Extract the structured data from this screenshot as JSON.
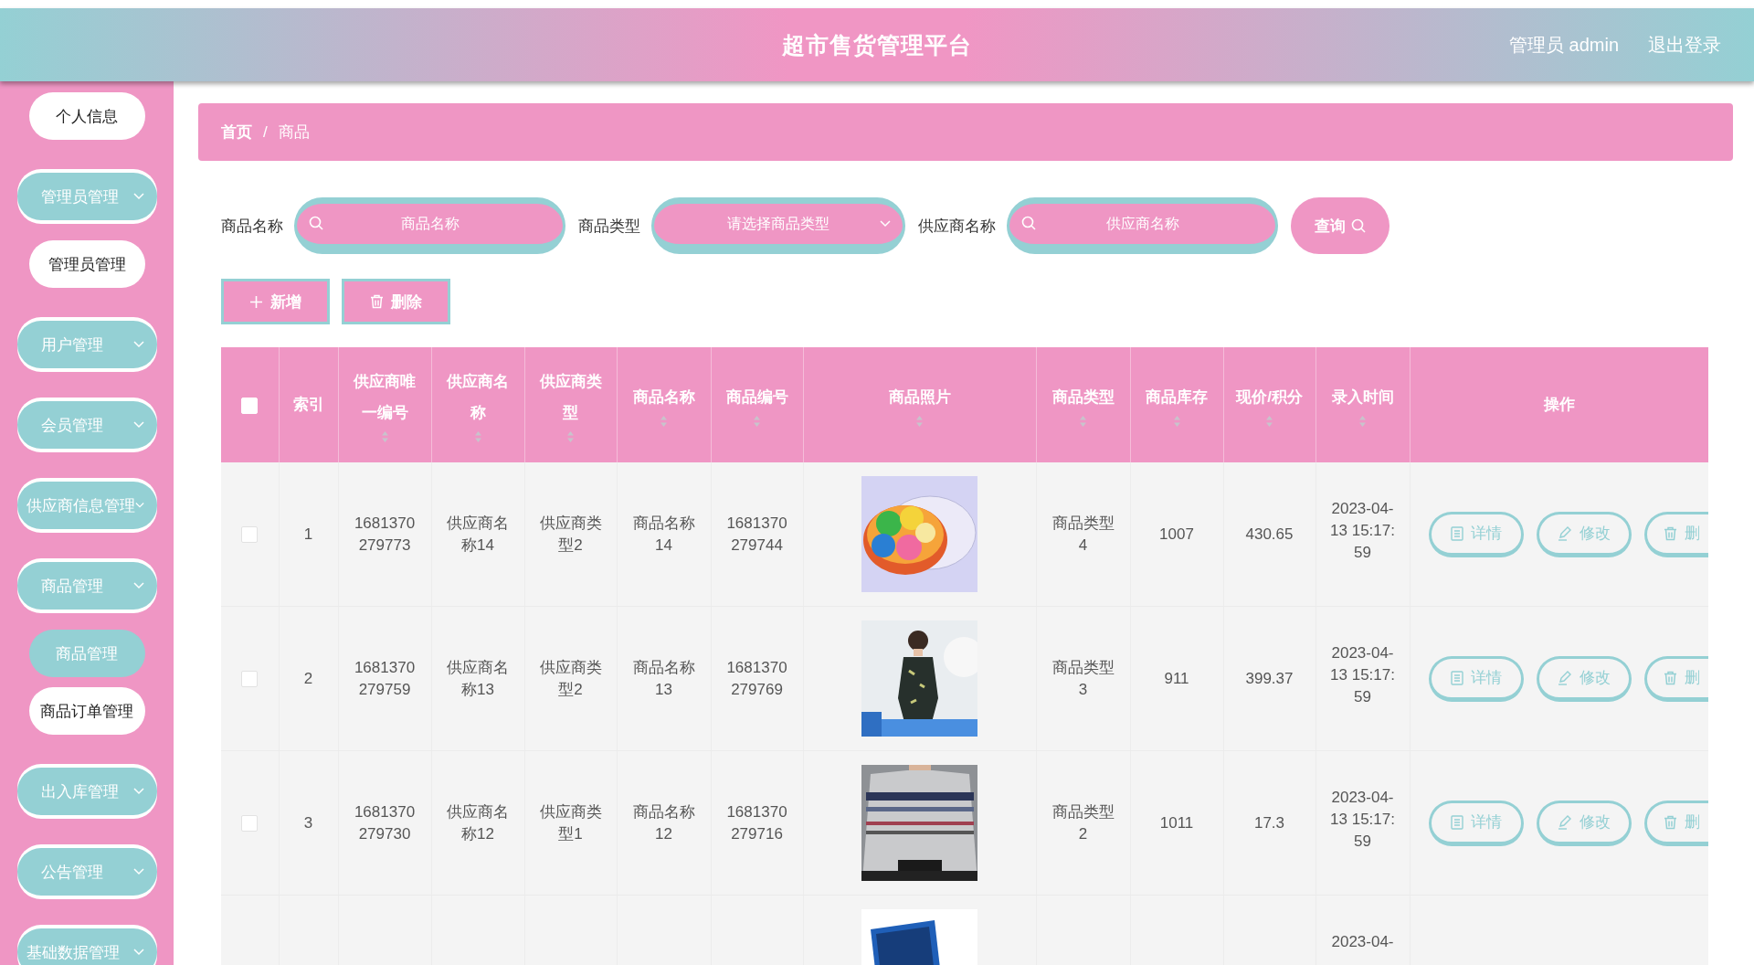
{
  "header": {
    "title": "超市售货管理平台",
    "user": "管理员 admin",
    "logout": "退出登录"
  },
  "sidebar": {
    "items": [
      {
        "kind": "item",
        "label": "个人信息",
        "selected": false
      },
      {
        "kind": "group",
        "label": "管理员管理",
        "children": [
          {
            "label": "管理员管理",
            "selected": false
          }
        ]
      },
      {
        "kind": "group",
        "label": "用户管理"
      },
      {
        "kind": "group",
        "label": "会员管理"
      },
      {
        "kind": "group",
        "label": "供应商信息管理"
      },
      {
        "kind": "group",
        "label": "商品管理",
        "children": [
          {
            "label": "商品管理",
            "selected": true
          },
          {
            "label": "商品订单管理",
            "selected": false
          }
        ]
      },
      {
        "kind": "group",
        "label": "出入库管理"
      },
      {
        "kind": "group",
        "label": "公告管理"
      },
      {
        "kind": "group",
        "label": "基础数据管理"
      }
    ]
  },
  "breadcrumb": [
    "首页",
    "商品"
  ],
  "breadcrumb_separator": "/",
  "filters": [
    {
      "kind": "input",
      "label": "商品名称",
      "placeholder": "商品名称"
    },
    {
      "kind": "select",
      "label": "商品类型",
      "placeholder": "请选择商品类型"
    },
    {
      "kind": "input",
      "label": "供应商名称",
      "placeholder": "供应商名称"
    }
  ],
  "search_button": "查询",
  "actions": [
    {
      "kind": "add",
      "label": "新增"
    },
    {
      "kind": "delete",
      "label": "删除"
    }
  ],
  "table": {
    "select_all": {
      "checked": false
    },
    "columns": [
      {
        "label": "索引",
        "sortable": false
      },
      {
        "label": "供应商唯一编号",
        "sortable": true
      },
      {
        "label": "供应商名称",
        "sortable": true
      },
      {
        "label": "供应商类型",
        "sortable": true
      },
      {
        "label": "商品名称",
        "sortable": true
      },
      {
        "label": "商品编号",
        "sortable": true
      },
      {
        "label": "商品照片",
        "sortable": true
      },
      {
        "label": "商品类型",
        "sortable": true
      },
      {
        "label": "商品库存",
        "sortable": true
      },
      {
        "label": "现价/积分",
        "sortable": true
      },
      {
        "label": "录入时间",
        "sortable": true
      },
      {
        "label": "操作",
        "sortable": false
      }
    ],
    "rows": [
      {
        "checked": false,
        "index": "1",
        "supplier_id": "1681370279773",
        "supplier_name": "供应商名称14",
        "supplier_type": "供应商类型2",
        "product_name": "商品名称14",
        "product_code": "1681370279744",
        "photo": {
          "kind": "picture"
        },
        "product_type": "商品类型4",
        "stock": "1007",
        "price": "430.65",
        "created": "2023-04-13 15:17:59",
        "buttons": [
          {
            "kind": "detail",
            "label": "详情"
          },
          {
            "kind": "edit",
            "label": "修改"
          },
          {
            "kind": "delete",
            "label": "删"
          }
        ]
      },
      {
        "checked": false,
        "index": "2",
        "supplier_id": "1681370279759",
        "supplier_name": "供应商名称13",
        "supplier_type": "供应商类型2",
        "product_name": "商品名称13",
        "product_code": "1681370279769",
        "photo": {
          "kind": "picture"
        },
        "product_type": "商品类型3",
        "stock": "911",
        "price": "399.37",
        "created": "2023-04-13 15:17:59",
        "buttons": [
          {
            "kind": "detail",
            "label": "详情"
          },
          {
            "kind": "edit",
            "label": "修改"
          },
          {
            "kind": "delete",
            "label": "删"
          }
        ]
      },
      {
        "checked": false,
        "index": "3",
        "supplier_id": "1681370279730",
        "supplier_name": "供应商名称12",
        "supplier_type": "供应商类型1",
        "product_name": "商品名称12",
        "product_code": "1681370279716",
        "photo": {
          "kind": "picture"
        },
        "product_type": "商品类型2",
        "stock": "1011",
        "price": "17.3",
        "created": "2023-04-13 15:17:59",
        "buttons": [
          {
            "kind": "detail",
            "label": "详情"
          },
          {
            "kind": "edit",
            "label": "修改"
          },
          {
            "kind": "delete",
            "label": "删"
          }
        ]
      },
      {
        "photo": {
          "kind": "picture"
        },
        "created": "2023-04-"
      }
    ]
  }
}
